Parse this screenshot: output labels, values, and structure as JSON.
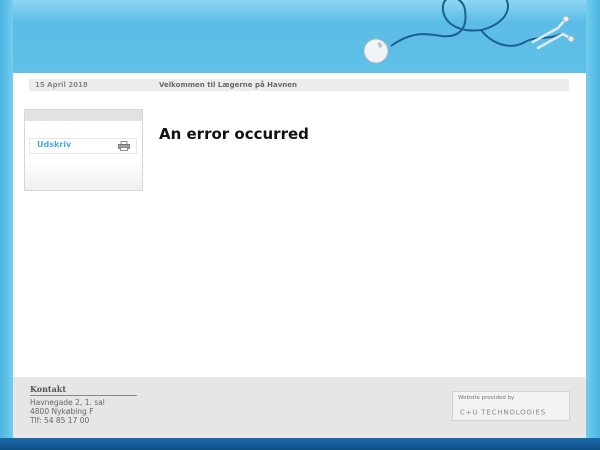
{
  "header": {
    "date": "15 April 2018",
    "welcome": "Velkommen til Lægerne på Havnen"
  },
  "sidebar": {
    "print_label": "Udskriv"
  },
  "main": {
    "error_title": "An error occurred"
  },
  "footer": {
    "title": "Kontakt",
    "address_line1": "Havnegade 2, 1. sal",
    "address_line2": "4800 Nykøbing F",
    "phone": "Tlf: 54 85 17 00",
    "provider_label": "Website provided by",
    "provider_logo_text": "C+U TECHNOLOGIES"
  },
  "icons": {
    "mouse": "computer-mouse-icon",
    "stethoscope": "stethoscope-icon",
    "print": "printer-icon"
  },
  "colors": {
    "header_blue": "#5fc1e6",
    "link_blue": "#4aa8d8",
    "bottom_band": "#0e4f86"
  }
}
